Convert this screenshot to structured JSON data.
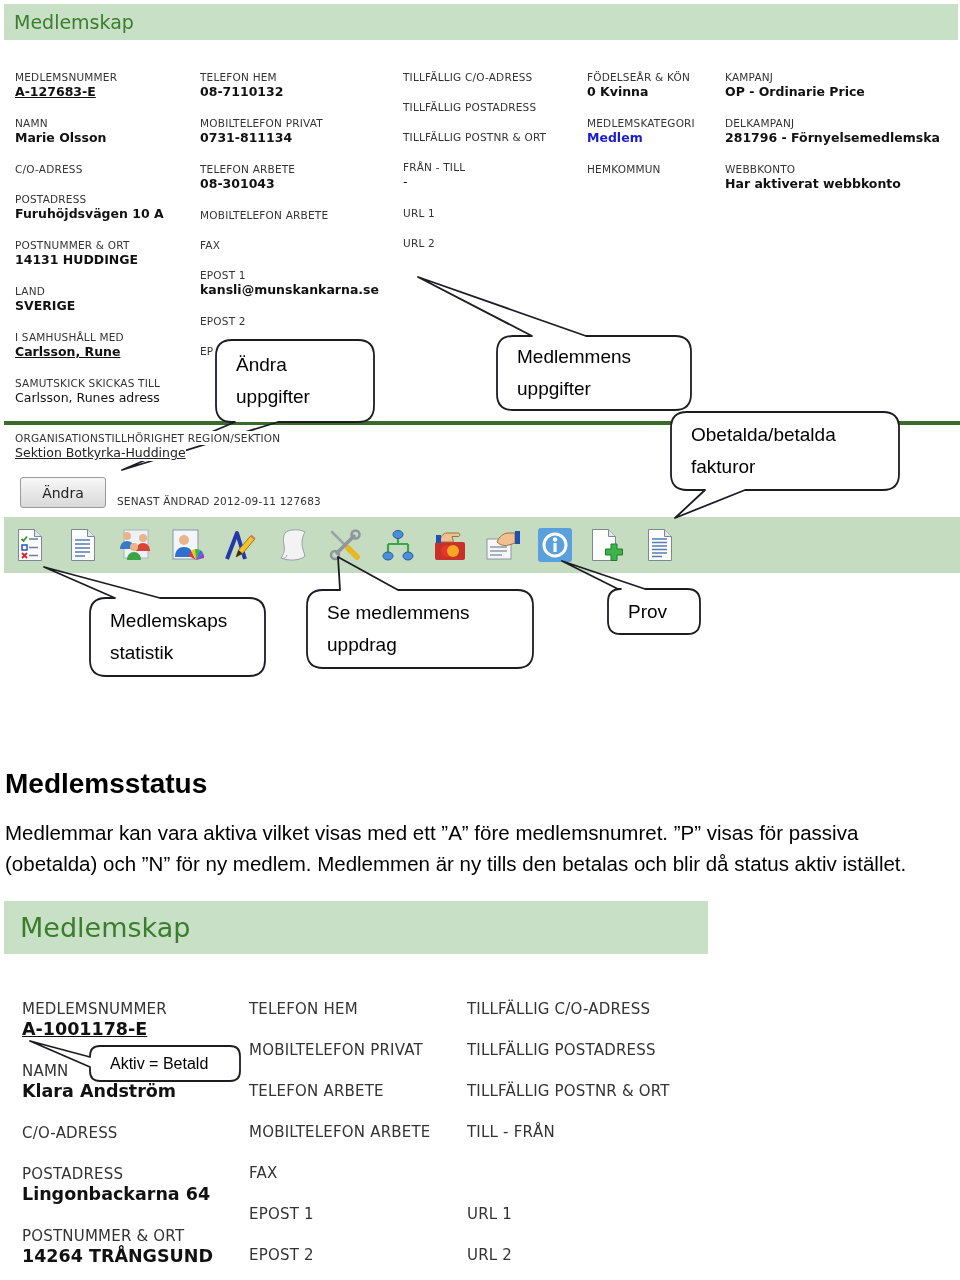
{
  "membership_screen": {
    "title": "Medlemskap",
    "columns": [
      [
        {
          "label": "MEDLEMSNUMMER",
          "value": "A-127683-E",
          "kind": "link"
        },
        {
          "label": "NAMN",
          "value": "Marie Olsson",
          "kind": "bold"
        },
        {
          "label": "C/O-ADRESS",
          "kind": "label"
        },
        {
          "label": "POSTADRESS",
          "value": "Furuhöjdsvägen 10 A",
          "kind": "bold"
        },
        {
          "label": "POSTNUMMER & ORT",
          "value": "14131 HUDDINGE",
          "kind": "bold"
        },
        {
          "label": "LAND",
          "value": "SVERIGE",
          "kind": "bold"
        },
        {
          "label": "I SAMHUSHÅLL MED",
          "value": "Carlsson, Rune",
          "kind": "link"
        },
        {
          "label": "SAMUTSKICK SKICKAS TILL",
          "value": "Carlsson, Runes adress",
          "kind": "plain"
        }
      ],
      [
        {
          "label": "TELEFON HEM",
          "value": "08-7110132",
          "kind": "bold"
        },
        {
          "label": "MOBILTELEFON PRIVAT",
          "value": "0731-811134",
          "kind": "bold"
        },
        {
          "label": "TELEFON ARBETE",
          "value": "08-301043",
          "kind": "bold"
        },
        {
          "label": "MOBILTELEFON ARBETE",
          "kind": "label"
        },
        {
          "label": "FAX",
          "kind": "label"
        },
        {
          "label": "EPOST 1",
          "value": "kansli@munskankarna.se",
          "kind": "bold"
        },
        {
          "label": "EPOST 2",
          "kind": "label"
        },
        {
          "label": "EP",
          "kind": "label"
        }
      ],
      [
        {
          "label": "TILLFÄLLIG C/O-ADRESS",
          "kind": "label"
        },
        {
          "label": "TILLFÄLLIG POSTADRESS",
          "kind": "label"
        },
        {
          "label": "TILLFÄLLIG POSTNR & ORT",
          "kind": "label"
        },
        {
          "label": "FRÅN - TILL",
          "value": "-",
          "kind": "plain"
        },
        {
          "label": "URL 1",
          "kind": "label"
        },
        {
          "label": "URL 2",
          "kind": "label"
        }
      ],
      [
        {
          "label": "FÖDELSEÅR & KÖN",
          "value": "0 Kvinna",
          "kind": "bold"
        },
        {
          "label": "MEDLEMSKATEGORI",
          "value": "Medlem",
          "kind": "accent"
        },
        {
          "label": "HEMKOMMUN",
          "kind": "label"
        }
      ],
      [
        {
          "label": "KAMPANJ",
          "value": "OP - Ordinarie Price",
          "kind": "bold"
        },
        {
          "label": "DELKAMPANJ",
          "value": "281796 - Förnyelsemedlemska",
          "kind": "bold"
        },
        {
          "label": "WEBBKONTO",
          "value": "Har aktiverat webbkonto",
          "kind": "bold"
        }
      ]
    ],
    "organization": {
      "label": "ORGANISATIONSTILLHÖRIGHET REGION/SEKTION",
      "value": "Sektion Botkyrka-Huddinge"
    },
    "edit_button": "Ändra",
    "last_changed": "SENAST ÄNDRAD 2012-09-11 127683",
    "callouts": [
      {
        "text": "Ändra uppgifter"
      },
      {
        "text": "Medlemmens uppgifter"
      },
      {
        "text": "Obetalda/betalda fakturor"
      },
      {
        "text": "Medlemskaps statistik"
      },
      {
        "text": "Se medlemmens uppdrag"
      },
      {
        "text": "Prov"
      }
    ]
  },
  "status_section": {
    "heading": "Medlemsstatus",
    "text": "Medlemmar kan vara aktiva vilket visas med ett ”A” före medlemsnumret. ”P” visas för passiva (obetalda) och ”N” för ny medlem. Medlemmen är ny tills den betalas och blir då status aktiv istället."
  },
  "status_screen": {
    "title": "Medlemskap",
    "columns": [
      [
        {
          "label": "MEDLEMSNUMMER",
          "value": "A-1001178-E",
          "kind": "link"
        },
        {
          "label": "NAMN",
          "value": "Klara Andström",
          "kind": "bold"
        },
        {
          "label": "C/O-ADRESS",
          "kind": "label"
        },
        {
          "label": "POSTADRESS",
          "value": "Lingonbackarna 64",
          "kind": "bold"
        },
        {
          "label": "POSTNUMMER & ORT",
          "value": "14264 TRÅNGSUND",
          "kind": "bold"
        }
      ],
      [
        {
          "label": "TELEFON HEM",
          "kind": "label"
        },
        {
          "label": "MOBILTELEFON PRIVAT",
          "kind": "label"
        },
        {
          "label": "TELEFON ARBETE",
          "kind": "label"
        },
        {
          "label": "MOBILTELEFON ARBETE",
          "kind": "label"
        },
        {
          "label": "FAX",
          "kind": "label"
        },
        {
          "label": "EPOST 1",
          "kind": "label"
        },
        {
          "label": "EPOST 2",
          "kind": "label"
        }
      ],
      [
        {
          "label": "TILLFÄLLIG C/O-ADRESS",
          "kind": "label"
        },
        {
          "label": "TILLFÄLLIG POSTADRESS",
          "kind": "label"
        },
        {
          "label": "TILLFÄLLIG POSTNR & ORT",
          "kind": "label"
        },
        {
          "label": "TILL - FRÅN",
          "kind": "label"
        },
        {
          "label": "URL 1",
          "kind": "label"
        },
        {
          "label": "URL 2",
          "kind": "label"
        }
      ]
    ],
    "callouts": [
      {
        "text": "Aktiv = Betald"
      }
    ]
  }
}
